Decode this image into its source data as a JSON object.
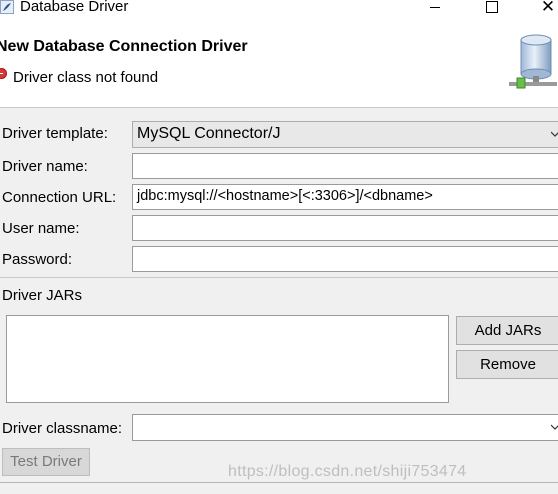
{
  "window": {
    "title": "Database Driver",
    "close_glyph": "✕"
  },
  "header": {
    "title": "New Database Connection Driver",
    "error_message": "Driver class not found",
    "icon": "database-icon"
  },
  "form": {
    "template_label": "Driver template:",
    "template_value": "MySQL Connector/J",
    "name_label": "Driver name:",
    "name_value": "",
    "url_label": "Connection URL:",
    "url_value": "jdbc:mysql://<hostname>[<:3306>]/<dbname>",
    "user_label": "User name:",
    "user_value": "",
    "password_label": "Password:",
    "password_value": ""
  },
  "jars": {
    "section_label": "Driver JARs",
    "items": [],
    "add_button": "Add JARs",
    "remove_button": "Remove"
  },
  "classname": {
    "label": "Driver classname:",
    "value": ""
  },
  "test_button": "Test Driver",
  "watermark": "https://blog.csdn.net/shiji753474"
}
